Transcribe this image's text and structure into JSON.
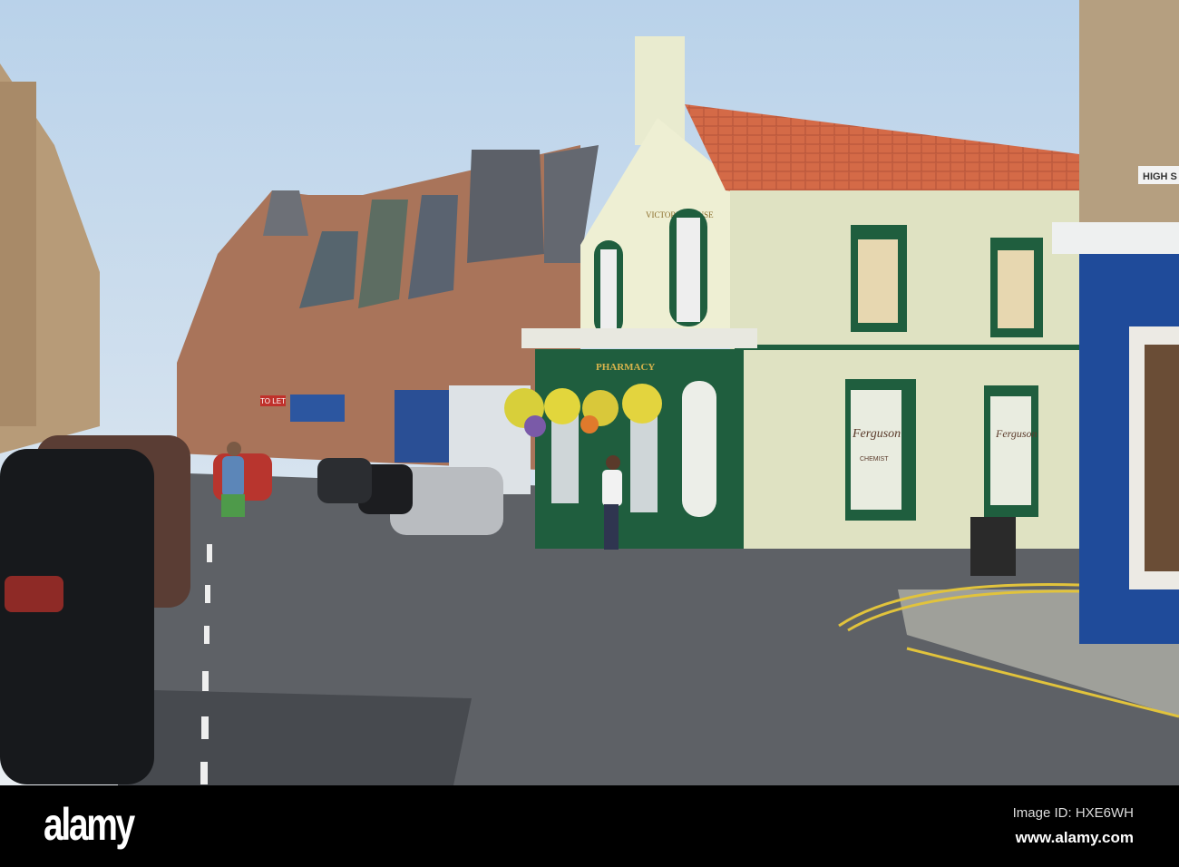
{
  "photo": {
    "description_signs": {
      "house_name": "VICTORIA HOUSE",
      "shop_sign": "PHARMACY",
      "window_name": "Ferguson",
      "window_sub": "CHEMIST",
      "right_window_name": "Ferguson",
      "to_let": "TO LET",
      "street_sign": "HIGH S"
    },
    "colors": {
      "sky": "#c9dcec",
      "road": "#5e6166",
      "roof_tile": "#d46a47",
      "facade": "#dfe2c2",
      "trim_green": "#1f5e3e",
      "shop_blue": "#2c56a0"
    }
  },
  "watermark": {
    "brand": "alamy",
    "image_id": "Image ID: HXE6WH",
    "url": "www.alamy.com"
  }
}
